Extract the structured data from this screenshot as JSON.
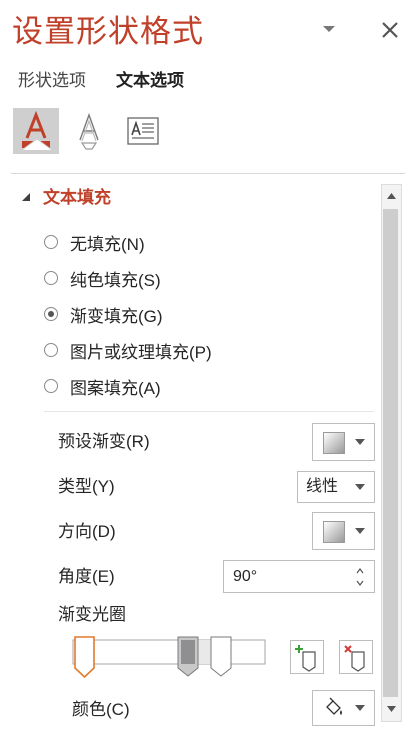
{
  "pane": {
    "title": "设置形状格式",
    "menu_icon": "chevron-down-icon",
    "close_icon": "close-icon"
  },
  "tabs": [
    {
      "label": "形状选项",
      "selected": false
    },
    {
      "label": "文本选项",
      "selected": true
    }
  ],
  "icon_tabs": [
    {
      "name": "text-fill-outline-icon",
      "selected": true
    },
    {
      "name": "text-effects-icon",
      "selected": false
    },
    {
      "name": "text-box-icon",
      "selected": false
    }
  ],
  "section": {
    "title": "文本填充",
    "expanded": true
  },
  "fill_options": [
    {
      "label": "无填充(N)",
      "selected": false
    },
    {
      "label": "纯色填充(S)",
      "selected": false
    },
    {
      "label": "渐变填充(G)",
      "selected": true
    },
    {
      "label": "图片或纹理填充(P)",
      "selected": false
    },
    {
      "label": "图案填充(A)",
      "selected": false
    }
  ],
  "gradient": {
    "preset_label": "预设渐变(R)",
    "type_label": "类型(Y)",
    "type_value": "线性",
    "direction_label": "方向(D)",
    "angle_label": "角度(E)",
    "angle_value": "90°",
    "stops_label": "渐变光圈",
    "stop_count": 3,
    "selected_stop": 1,
    "color_label": "颜色(C)"
  },
  "colors": {
    "accent": "#c0402a",
    "text": "#262626",
    "selected_icon_bg": "#cfcfcf",
    "stop_highlight": "#e07b2e"
  }
}
